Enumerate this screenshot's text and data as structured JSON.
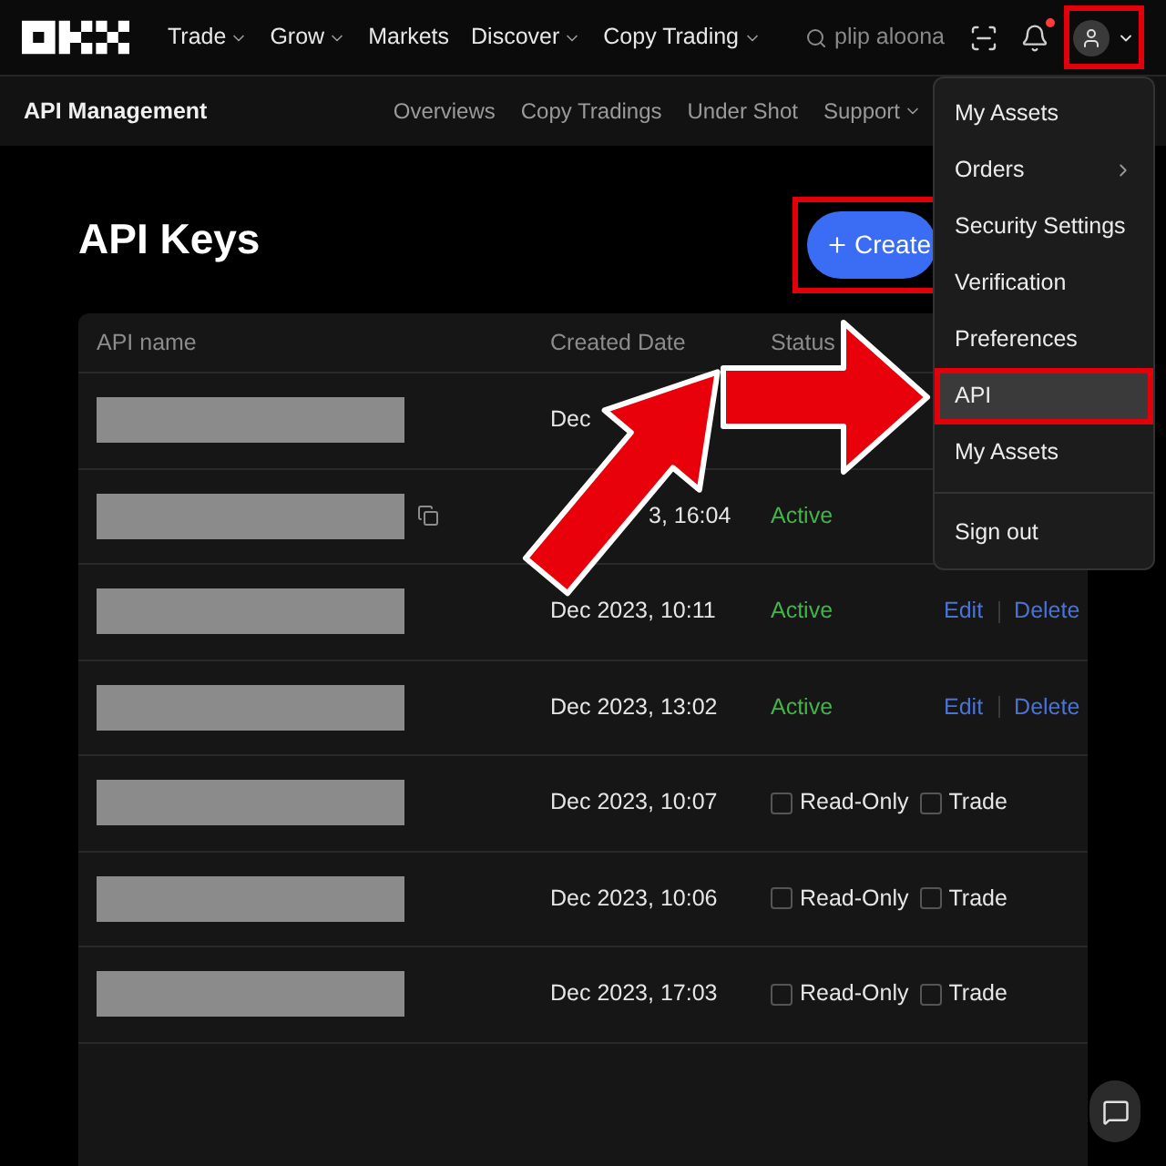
{
  "top_nav": {
    "items": [
      {
        "label": "Trade",
        "dropdown": true
      },
      {
        "label": "Grow",
        "dropdown": true
      },
      {
        "label": "Markets",
        "dropdown": false
      },
      {
        "label": "Discover",
        "dropdown": true
      },
      {
        "label": "Copy Trading",
        "dropdown": true
      }
    ],
    "search": {
      "placeholder": "plip aloona"
    },
    "notifications": {
      "unread": true
    },
    "account_button": {
      "marked": true
    }
  },
  "sub_nav": {
    "title": "API Management",
    "links": [
      {
        "label": "Overviews",
        "dropdown": false
      },
      {
        "label": "Copy Tradings",
        "dropdown": false
      },
      {
        "label": "Under Shot",
        "dropdown": false
      },
      {
        "label": "Support",
        "dropdown": true
      }
    ]
  },
  "page": {
    "title": "API Keys",
    "create_button": {
      "label": "Create",
      "marked": true
    }
  },
  "table": {
    "columns": [
      "API name",
      "Created Date",
      "Status"
    ],
    "rows": [
      {
        "kind": "status",
        "date": "Dec",
        "copyable": false
      },
      {
        "kind": "status",
        "date": "3, 16:04",
        "status": "Active",
        "copyable": true
      },
      {
        "kind": "status",
        "date": "Dec 2023, 10:11",
        "status": "Active",
        "actions": [
          "Edit",
          "Delete"
        ],
        "copyable": false
      },
      {
        "kind": "status",
        "date": "Dec 2023, 13:02",
        "status": "Active",
        "actions": [
          "Edit",
          "Delete"
        ],
        "copyable": false
      },
      {
        "kind": "permissions",
        "date": "Dec 2023, 10:07",
        "permissions": [
          {
            "label": "Read-Only",
            "checked": false
          },
          {
            "label": "Trade",
            "checked": false
          }
        ],
        "copyable": false
      },
      {
        "kind": "permissions",
        "date": "Dec 2023, 10:06",
        "permissions": [
          {
            "label": "Read-Only",
            "checked": false
          },
          {
            "label": "Trade",
            "checked": false
          }
        ],
        "copyable": false
      },
      {
        "kind": "permissions",
        "date": "Dec 2023, 17:03",
        "permissions": [
          {
            "label": "Read-Only",
            "checked": false
          },
          {
            "label": "Trade",
            "checked": false
          }
        ],
        "copyable": false
      }
    ]
  },
  "account_menu": {
    "items": [
      {
        "label": "My Assets",
        "submenu": false,
        "selected": false,
        "marked": false
      },
      {
        "label": "Orders",
        "submenu": true,
        "selected": false,
        "marked": false
      },
      {
        "label": "Security Settings",
        "submenu": false,
        "selected": false,
        "marked": false
      },
      {
        "label": "Verification",
        "submenu": false,
        "selected": false,
        "marked": false
      },
      {
        "label": "Preferences",
        "submenu": false,
        "selected": false,
        "marked": false
      },
      {
        "label": "API",
        "submenu": false,
        "selected": true,
        "marked": true
      },
      {
        "label": "My Assets",
        "submenu": false,
        "selected": false,
        "marked": false
      }
    ],
    "sign_out": "Sign out"
  }
}
